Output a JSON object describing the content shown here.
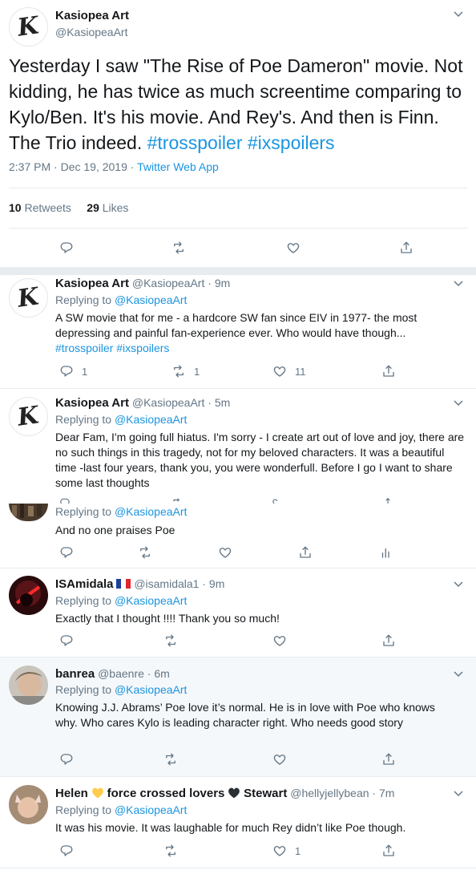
{
  "main_tweet": {
    "name": "Kasiopea Art",
    "handle": "@KasiopeaArt",
    "text_plain": "Yesterday I saw \"The Rise of Poe Dameron\" movie. Not kidding, he has twice as much screentime comparing to Kylo/Ben. It's his movie. And Rey's. And then is Finn. The Trio indeed.",
    "hashtags": [
      "#trosspoiler",
      "#ixspoilers"
    ],
    "time": "2:37 PM",
    "date": "Dec 19, 2019",
    "source": "Twitter Web App",
    "retweets_count": "10",
    "retweets_label": "Retweets",
    "likes_count": "29",
    "likes_label": "Likes"
  },
  "replies": [
    {
      "name": "Kasiopea Art",
      "handle": "@KasiopeaArt",
      "time": "9m",
      "replying_prefix": "Replying to",
      "replying_to": "@KasiopeaArt",
      "text": "A SW movie that for me - a hardcore SW fan since EIV in 1977- the most depressing and painful fan-experience ever. Who would have though...",
      "hashtags": "#trosspoiler #ixspoilers",
      "reply_count": "1",
      "retweet_count": "1",
      "like_count": "11"
    },
    {
      "name": "Kasiopea Art",
      "handle": "@KasiopeaArt",
      "time": "5m",
      "replying_prefix": "Replying to",
      "replying_to": "@KasiopeaArt",
      "text": "Dear Fam, I'm going full hiatus. I'm sorry - I create art out of love and joy, there are no such things in this tragedy, not for my beloved characters. It was a beautiful time -last four years, thank you, you were wonderfull. Before I go I want to share some last thoughts"
    },
    {
      "replying_prefix": "Replying to",
      "replying_to": "@KasiopeaArt",
      "text": "And no one praises Poe"
    },
    {
      "name": "ISAmidala",
      "handle": "@isamidala1",
      "time": "9m",
      "replying_prefix": "Replying to",
      "replying_to": "@KasiopeaArt",
      "text": "Exactly that I thought !!!! Thank you so much!"
    },
    {
      "name": "banrea",
      "handle": "@baenre",
      "time": "6m",
      "replying_prefix": "Replying to",
      "replying_to": "@KasiopeaArt",
      "text": "Knowing J.J. Abrams’ Poe love it’s normal. He is in love with Poe who knows why. Who cares Kylo is leading character right. Who needs good story"
    },
    {
      "name_part1": "Helen",
      "name_part2": "force crossed lovers",
      "name_part3": "Stewart",
      "handle": "@hellyjellybean",
      "time": "7m",
      "replying_prefix": "Replying to",
      "replying_to": "@KasiopeaArt",
      "text": "It was his movie. It was laughable for much Rey didn’t like Poe though.",
      "like_count": "1"
    }
  ],
  "separator": "·",
  "colors": {
    "link": "#1b95e0",
    "secondary": "#657786",
    "divider": "#e6ecf0",
    "highlight": "#f5f8fa"
  },
  "avatar_letter": "K"
}
